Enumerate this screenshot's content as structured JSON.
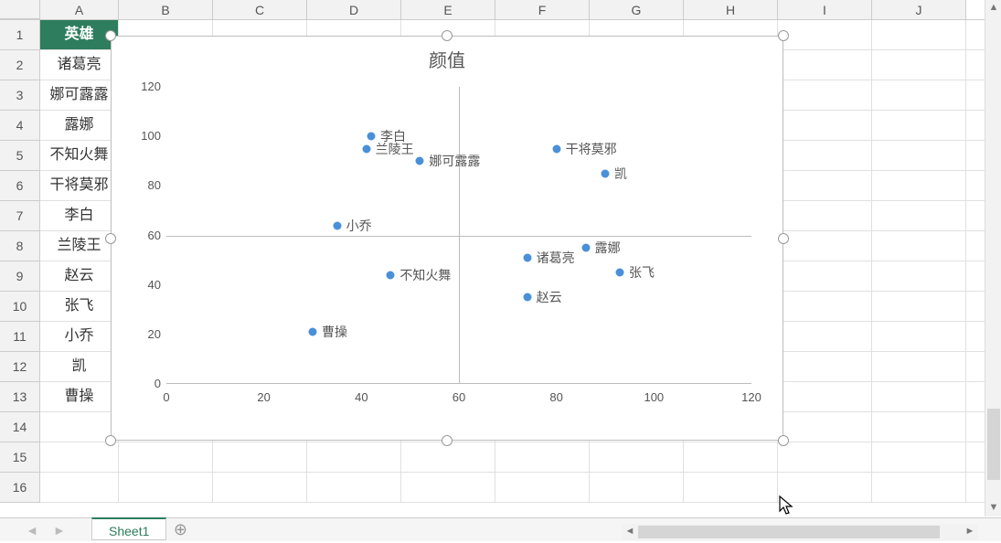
{
  "column_widths": {
    "A": 86,
    "default": 103
  },
  "columns": [
    "A",
    "B",
    "C",
    "D",
    "E",
    "F",
    "G",
    "H",
    "I",
    "J"
  ],
  "rows": [
    "1",
    "2",
    "3",
    "4",
    "5",
    "6",
    "7",
    "8",
    "9",
    "10",
    "11",
    "12",
    "13",
    "14",
    "15",
    "16"
  ],
  "a_header": "英雄",
  "a_values": [
    "诸葛亮",
    "娜可露露",
    "露娜",
    "不知火舞",
    "干将莫邪",
    "李白",
    "兰陵王",
    "赵云",
    "张飞",
    "小乔",
    "凯",
    "曹操"
  ],
  "sheet_tab": "Sheet1",
  "chart_data": {
    "type": "scatter",
    "title": "颜值",
    "xlabel": "",
    "ylabel": "",
    "xlim": [
      0,
      120
    ],
    "ylim": [
      0,
      120
    ],
    "x_ticks": [
      0,
      20,
      40,
      60,
      80,
      100,
      120
    ],
    "y_ticks": [
      0,
      20,
      40,
      60,
      80,
      100,
      120
    ],
    "crosshair_x": 60,
    "crosshair_y": 60,
    "series": [
      {
        "name": "颜值",
        "points": [
          {
            "label": "李白",
            "x": 42,
            "y": 100
          },
          {
            "label": "兰陵王",
            "x": 41,
            "y": 95
          },
          {
            "label": "娜可露露",
            "x": 52,
            "y": 90
          },
          {
            "label": "干将莫邪",
            "x": 80,
            "y": 95
          },
          {
            "label": "凯",
            "x": 90,
            "y": 85
          },
          {
            "label": "小乔",
            "x": 35,
            "y": 64
          },
          {
            "label": "露娜",
            "x": 86,
            "y": 55
          },
          {
            "label": "诸葛亮",
            "x": 74,
            "y": 51
          },
          {
            "label": "不知火舞",
            "x": 46,
            "y": 44
          },
          {
            "label": "赵云",
            "x": 74,
            "y": 35
          },
          {
            "label": "张飞",
            "x": 93,
            "y": 45
          },
          {
            "label": "曹操",
            "x": 30,
            "y": 21
          }
        ]
      }
    ]
  }
}
